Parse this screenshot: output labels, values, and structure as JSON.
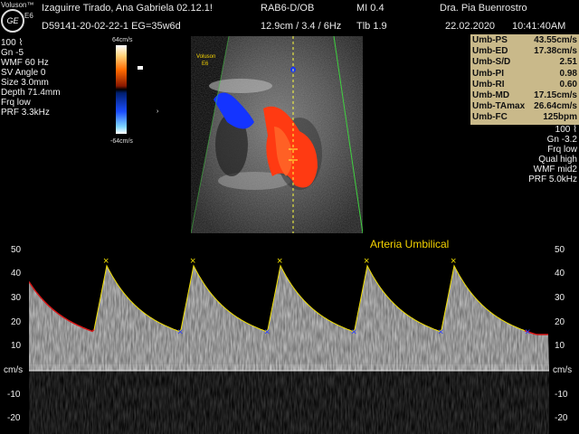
{
  "header": {
    "brand": "Voluson™",
    "model": "E6",
    "logo": "GE",
    "patient": "Izaguirre Tirado, Ana Gabriela  02.12.1!",
    "probe": "RAB6-D/OB",
    "mi": "MI  0.4",
    "doctor": "Dra. Pia Buenrostro",
    "exam_id": "D59141-20-02-22-1  EG=35w6d",
    "depth_info": "12.9cm / 3.4 /  6Hz",
    "tib": "Tlb  1.9",
    "date": "22.02.2020",
    "time": "10:41:40AM"
  },
  "left_params": [
    "100 ⌇",
    "Gn  -5",
    "WMF 60 Hz",
    "SV Angle  0",
    "Size  3.0mm",
    "Depth 71.4mm",
    "Frq low",
    "PRF  3.3kHz"
  ],
  "color_bar": {
    "top_label": "64cm/s",
    "bottom_label": "-64cm/s"
  },
  "image_overlay": {
    "brand": "Voluson",
    "model": "E6"
  },
  "measurements": [
    {
      "label": "Umb-PS",
      "value": "43.55cm/s"
    },
    {
      "label": "Umb-ED",
      "value": "17.38cm/s"
    },
    {
      "label": "Umb-S/D",
      "value": "2.51"
    },
    {
      "label": "Umb-PI",
      "value": "0.98"
    },
    {
      "label": "Umb-RI",
      "value": "0.60"
    },
    {
      "label": "Umb-MD",
      "value": "17.15cm/s"
    },
    {
      "label": "Umb-TAmax",
      "value": "26.64cm/s"
    },
    {
      "label": "Umb-FC",
      "value": "125bpm"
    }
  ],
  "right_params": [
    "100 ⌇",
    "Gn -3.2",
    "Frq low",
    "Qual high",
    "WMF mid2",
    "PRF  5.0kHz"
  ],
  "trace_title": "Arteria Umbilical",
  "velocity_unit": "cm/s",
  "velocity_ticks": [
    50,
    40,
    30,
    20,
    10,
    -10,
    -20
  ],
  "colors": {
    "trace_yellow": "#f2e000",
    "trace_red": "#d81818",
    "flow_red": "#ff3a12",
    "flow_blue": "#1434ff",
    "panel": "#c9b98a"
  }
}
